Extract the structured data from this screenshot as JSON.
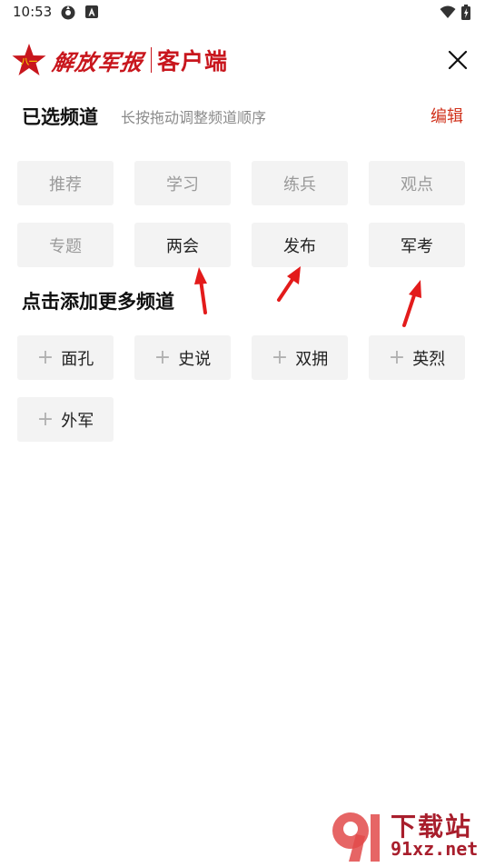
{
  "status_bar": {
    "time": "10:53"
  },
  "header": {
    "logo_text": "解放军报",
    "app_name": "客户端",
    "brand_color": "#c8161d"
  },
  "selected": {
    "title": "已选频道",
    "hint": "长按拖动调整频道顺序",
    "edit_label": "编辑",
    "fixed_channels": [
      "推荐",
      "学习",
      "练兵",
      "观点",
      "专题"
    ],
    "movable_channels": [
      "两会",
      "发布",
      "军考"
    ]
  },
  "more": {
    "title": "点击添加更多频道",
    "add_symbol": "+",
    "channels": [
      "面孔",
      "史说",
      "双拥",
      "英烈",
      "外军"
    ]
  },
  "watermark": {
    "text": "下载站",
    "url": "91xz.net"
  }
}
